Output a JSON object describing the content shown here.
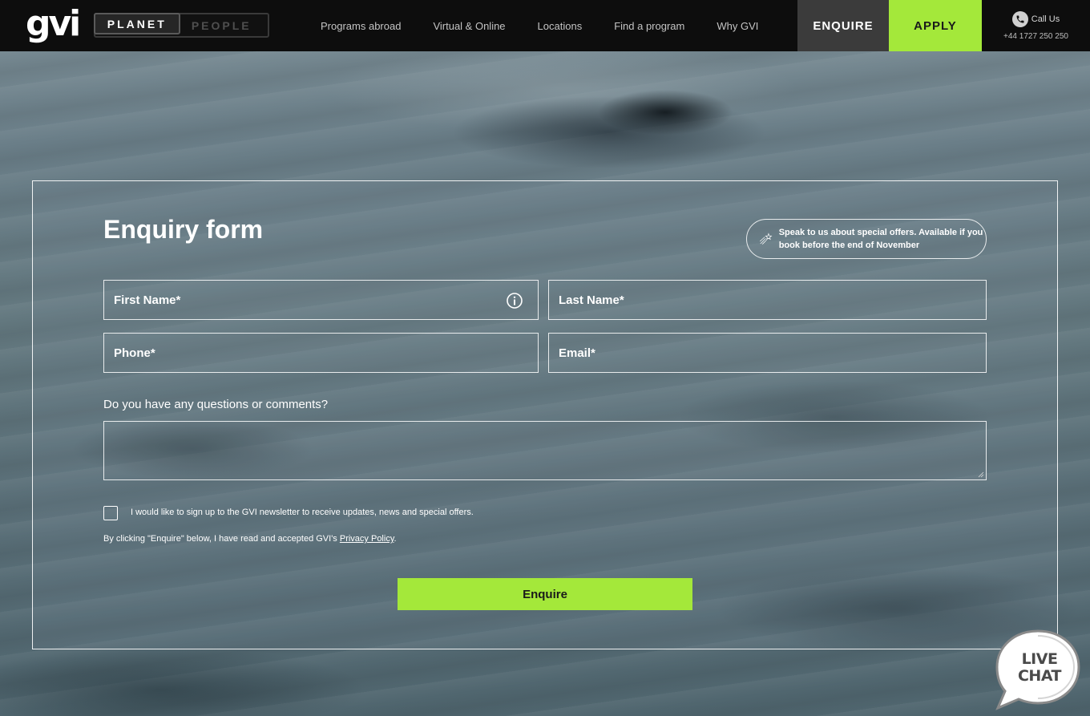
{
  "header": {
    "logo": "gvi",
    "toggle": {
      "active": "PLANET",
      "inactive": "PEOPLE"
    },
    "nav": [
      "Programs abroad",
      "Virtual & Online",
      "Locations",
      "Find a program",
      "Why GVI"
    ],
    "enquire_label": "ENQUIRE",
    "apply_label": "APPLY",
    "call_label": "Call Us",
    "call_number": "+44 1727 250 250"
  },
  "form": {
    "title": "Enquiry form",
    "offer": "Speak to us about special offers. Available if you book before the end of November",
    "first_name_placeholder": "First Name*",
    "last_name_placeholder": "Last Name*",
    "phone_placeholder": "Phone*",
    "email_placeholder": "Email*",
    "question_label": "Do you have any questions or comments?",
    "newsletter_label": "I would like to sign up to the GVI newsletter to receive updates, news and special offers.",
    "privacy_prefix": "By clicking \"Enquire\" below, I have read and accepted GVI's ",
    "privacy_link": "Privacy Policy",
    "privacy_suffix": ".",
    "submit_label": "Enquire"
  },
  "livechat": {
    "line1": "LIVE",
    "line2": "CHAT"
  },
  "colors": {
    "accent": "#a4e83a",
    "header_bg": "#0d0d0d",
    "enquire_bg": "#3b3b3b"
  }
}
